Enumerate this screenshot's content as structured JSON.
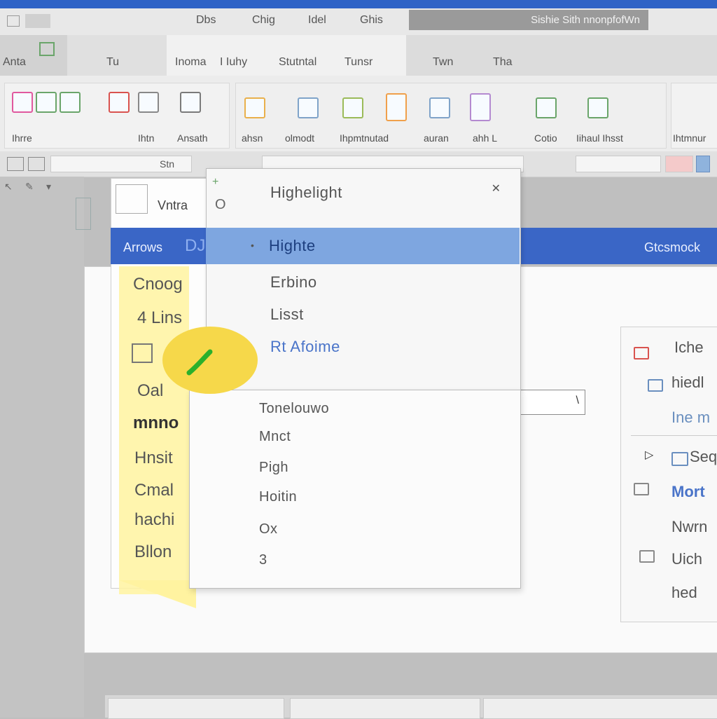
{
  "tabs": {
    "items": [
      "Dbs",
      "Chig",
      "Idel",
      "Ghis"
    ],
    "right_title": "Sishie Sith nnonpfofWn"
  },
  "ribbon_tabs": [
    "Anta",
    "Tu",
    "Inoma",
    "I Iuhy",
    "Stutntal",
    "Tunsr",
    "Twn",
    "Tha"
  ],
  "ribbon_groups": [
    {
      "label": "Ihrre"
    },
    {
      "label": "Ihtn"
    },
    {
      "label": "Ansath"
    },
    {
      "label": "ahsn"
    },
    {
      "label": "olmodt"
    },
    {
      "label": "Ihpmtnutad"
    },
    {
      "label": "auran"
    },
    {
      "label": "ahh L"
    },
    {
      "label": "Cotio"
    },
    {
      "label": "Iihaul Ihsst"
    },
    {
      "label": "Ihtmnur"
    }
  ],
  "toolbar2": {
    "label": "Stn"
  },
  "left_panel": {
    "top_label": "Vntra",
    "items": [
      "Cnoog",
      "4 Lins",
      "Oal",
      "mnno",
      "Hnsit",
      "Cmal",
      "hachi",
      "Bllon"
    ]
  },
  "blue_bar": {
    "left": "Arrows",
    "left_extra": "DJ",
    "right": "Gtcsmock"
  },
  "dropdown": {
    "upper": [
      "Highelight",
      "Highte",
      "Erbino",
      "Lisst",
      "Rt Afoime"
    ],
    "lower": [
      "Tonelouwo",
      "Mnct",
      "Pigh",
      "Hoitin",
      "Ox",
      "3"
    ]
  },
  "right_panel": {
    "items": [
      "Iche",
      "hiedl",
      "Ine m",
      "Seq",
      "Mort",
      "Nwrn",
      "Uich",
      "hed"
    ]
  },
  "colors": {
    "accent": "#3a66c6",
    "selection": "#7ea6e0",
    "highlight_yellow": "#f6d84a",
    "link_blue": "#4a74c9"
  }
}
